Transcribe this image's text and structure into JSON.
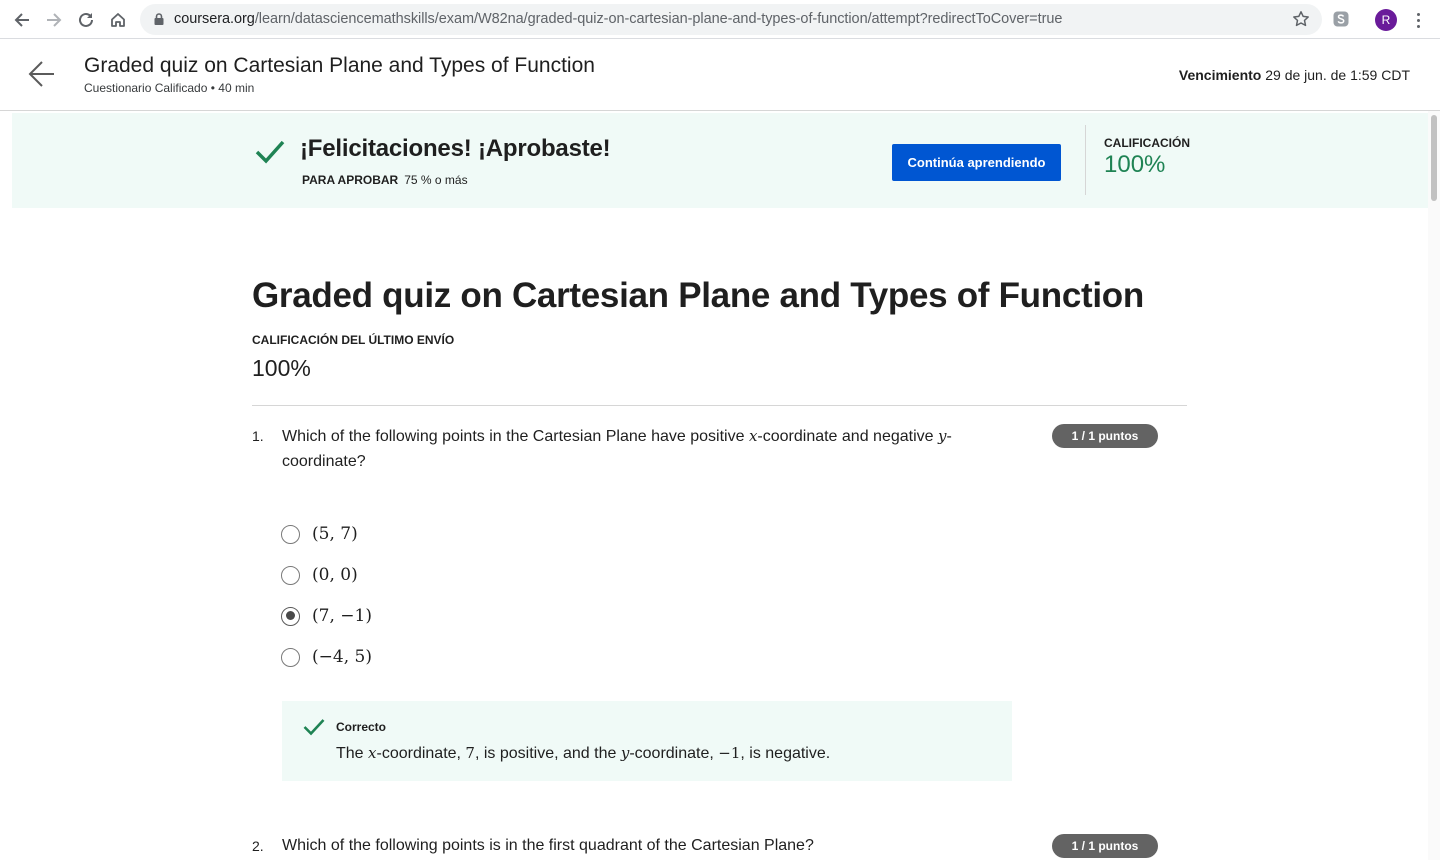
{
  "browser": {
    "url_host": "coursera.org",
    "url_path": "/learn/datasciencemathskills/exam/W82na/graded-quiz-on-cartesian-plane-and-types-of-function/attempt?redirectToCover=true",
    "profile_initial": "R"
  },
  "header": {
    "title": "Graded quiz on Cartesian Plane and Types of Function",
    "subtitle": "Cuestionario Calificado • 40 min",
    "due_label": "Vencimiento",
    "due_value": "29 de jun. de 1:59 CDT"
  },
  "banner": {
    "title": "¡Felicitaciones! ¡Aprobaste!",
    "pass_label": "PARA APROBAR",
    "pass_value": "75 % o más",
    "continue_label": "Continúa aprendiendo",
    "grade_label": "CALIFICACIÓN",
    "grade_value": "100%"
  },
  "main": {
    "title": "Graded quiz on Cartesian Plane and Types of Function",
    "last_submission_label": "CALIFICACIÓN DEL ÚLTIMO ENVÍO",
    "last_submission_value": "100%"
  },
  "questions": [
    {
      "number": "1.",
      "text_a": "Which of the following points in the Cartesian Plane have positive ",
      "var_x": "x",
      "text_b": "-coordinate and negative ",
      "var_y": "y",
      "text_c": "-coordinate?",
      "points": "1 / 1 puntos",
      "options": [
        {
          "label": "(5, 7)",
          "selected": false
        },
        {
          "label": "(0, 0)",
          "selected": false
        },
        {
          "label": "(7, −1)",
          "selected": true
        },
        {
          "label": "(−4, 5)",
          "selected": false
        }
      ],
      "feedback": {
        "status": "Correcto",
        "t1": "The ",
        "x": "x",
        "t2": "-coordinate, ",
        "v1": "7",
        "t3": ", is positive, and the ",
        "y": "y",
        "t4": "-coordinate, ",
        "v2": "−1",
        "t5": ", is negative."
      }
    },
    {
      "number": "2.",
      "text": "Which of the following points is in the first quadrant of the Cartesian Plane?",
      "points": "1 / 1 puntos"
    }
  ],
  "colors": {
    "accent_blue": "#0056d2",
    "success_green": "#1f8354",
    "banner_bg": "#f0faf7",
    "points_badge": "#636363"
  }
}
